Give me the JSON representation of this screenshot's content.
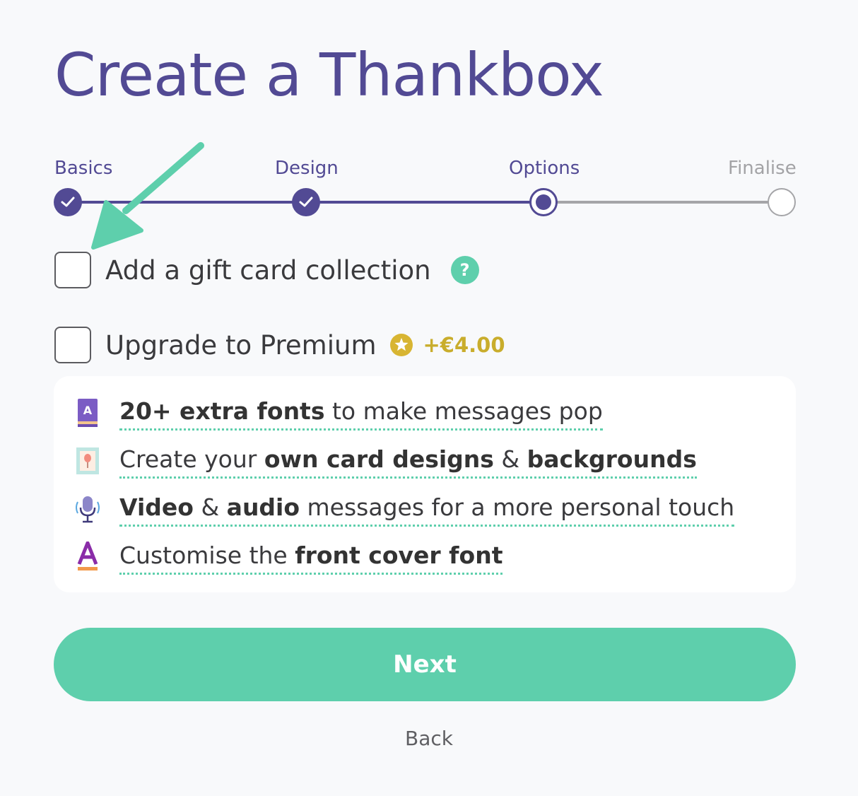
{
  "page": {
    "title": "Create a Thankbox"
  },
  "stepper": {
    "steps": [
      {
        "label": "Basics",
        "state": "done"
      },
      {
        "label": "Design",
        "state": "done"
      },
      {
        "label": "Options",
        "state": "active"
      },
      {
        "label": "Finalise",
        "state": "todo"
      }
    ]
  },
  "options": {
    "gift_card": {
      "label": "Add a gift card collection",
      "checked": false,
      "help_icon": "?"
    },
    "premium": {
      "label": "Upgrade to Premium",
      "checked": false,
      "price": "+€4.00",
      "icon": "star-icon"
    }
  },
  "features": [
    {
      "icon": "book-icon",
      "parts": [
        [
          "20+ extra fonts",
          true
        ],
        [
          " to make messages pop",
          false
        ]
      ]
    },
    {
      "icon": "picture-icon",
      "parts": [
        [
          "Create your ",
          false
        ],
        [
          "own card designs",
          true
        ],
        [
          " & ",
          false
        ],
        [
          "backgrounds",
          true
        ]
      ]
    },
    {
      "icon": "microphone-icon",
      "parts": [
        [
          "Video",
          true
        ],
        [
          " & ",
          false
        ],
        [
          "audio",
          true
        ],
        [
          " messages for a more personal touch",
          false
        ]
      ]
    },
    {
      "icon": "letter-a-icon",
      "parts": [
        [
          "Customise the ",
          false
        ],
        [
          "front cover font",
          true
        ]
      ]
    }
  ],
  "actions": {
    "next_label": "Next",
    "back_label": "Back"
  },
  "colors": {
    "brand_purple": "#524a94",
    "accent_green": "#5ecfac",
    "price_gold": "#c9ad2c"
  }
}
